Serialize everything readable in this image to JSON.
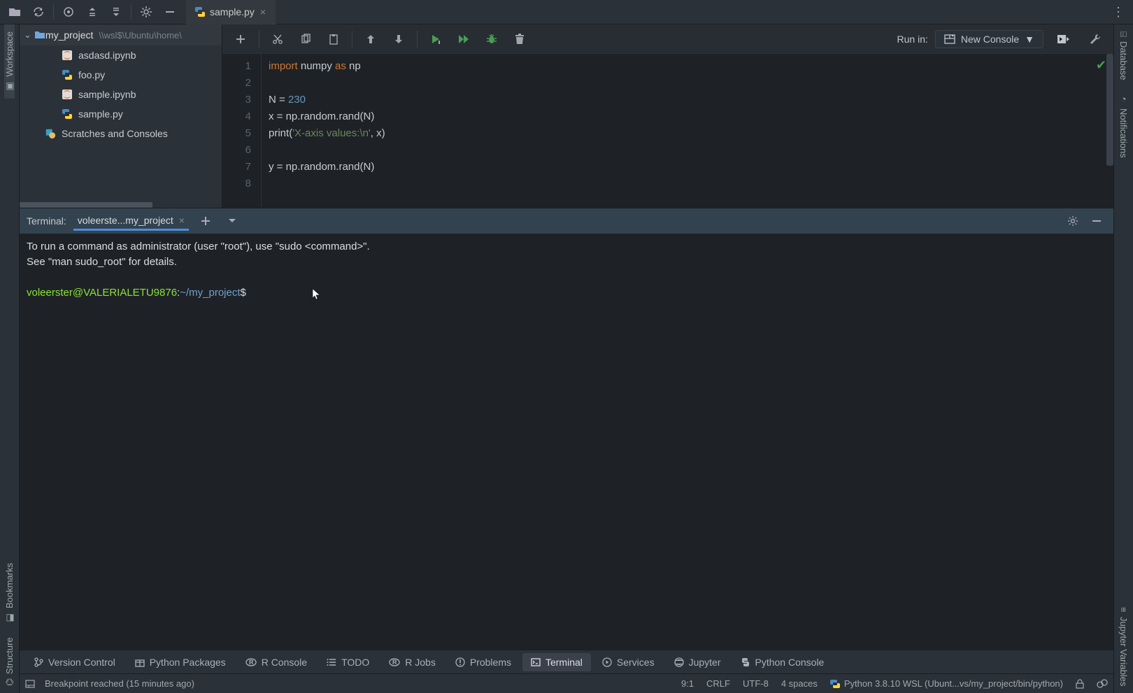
{
  "tab": {
    "filename": "sample.py"
  },
  "project": {
    "name": "my_project",
    "path": "\\\\wsl$\\Ubuntu\\home\\",
    "files": [
      "asdasd.ipynb",
      "foo.py",
      "sample.ipynb",
      "sample.py"
    ],
    "scratches": "Scratches and Consoles"
  },
  "editor": {
    "runin_label": "Run in:",
    "runin_value": "New Console",
    "lines": [
      "1",
      "2",
      "3",
      "4",
      "5",
      "6",
      "7",
      "8"
    ]
  },
  "code": {
    "l1a": "import",
    "l1b": " numpy ",
    "l1c": "as",
    "l1d": " np",
    "l3a": "N = ",
    "l3b": "230",
    "l4": "x = np.random.rand(N)",
    "l5a": "print",
    "l5b": "(",
    "l5c": "'X-axis values:\\n'",
    "l5d": ", x)",
    "l7": "y = np.random.rand(N)"
  },
  "terminal": {
    "title": "Terminal:",
    "tab": "voleerste...my_project",
    "line1": "To run a command as administrator (user \"root\"), use \"sudo <command>\".",
    "line2": "See \"man sudo_root\" for details.",
    "prompt_user": "voleerster@VALERIALETU9876",
    "prompt_sep": ":",
    "prompt_path": "~/my_project",
    "prompt_end": "$"
  },
  "toolwindows": {
    "vc": "Version Control",
    "pp": "Python Packages",
    "rc": "R Console",
    "todo": "TODO",
    "rj": "R Jobs",
    "pr": "Problems",
    "term": "Terminal",
    "sv": "Services",
    "jup": "Jupyter",
    "pc": "Python Console"
  },
  "status": {
    "msg": "Breakpoint reached (15 minutes ago)",
    "pos": "9:1",
    "eol": "CRLF",
    "enc": "UTF-8",
    "indent": "4 spaces",
    "interp": "Python 3.8.10 WSL (Ubunt...vs/my_project/bin/python)"
  },
  "leftbar": {
    "workspace": "Workspace",
    "bookmarks": "Bookmarks",
    "structure": "Structure"
  },
  "rightbar": {
    "database": "Database",
    "notifications": "Notifications",
    "jv": "Jupyter Variables"
  }
}
